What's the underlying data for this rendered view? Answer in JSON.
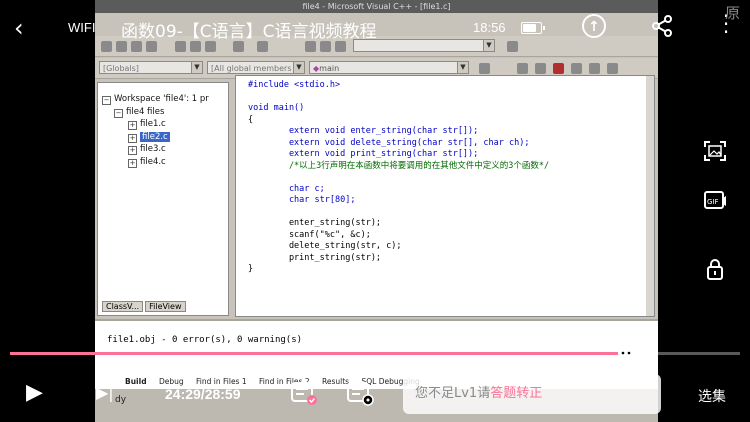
{
  "topbar": {
    "network": "WIFI",
    "title": "函数09-【C语言】C语言视频教程",
    "clock": "18:56",
    "watermark": "原"
  },
  "vs": {
    "window_title": "file4 - Microsoft Visual C++ - [file1.c]",
    "globals_combo": "[Globals]",
    "members_combo": "[All global members",
    "function_combo": "main",
    "workspace_label": "Workspace 'file4': 1 pr",
    "project_label": "file4 files",
    "files": [
      "file1.c",
      "file2.c",
      "file3.c",
      "file4.c"
    ],
    "ws_tabs": [
      "ClassV...",
      "FileView"
    ],
    "code_lines": [
      "#include <stdio.h>",
      "",
      "void main()",
      "{",
      "        extern void enter_string(char str[]);",
      "        extern void delete_string(char str[], char ch);",
      "        extern void print_string(char str[]);",
      "        /*以上3行声明在本函数中将要调用的在其他文件中定义的3个函数*/",
      "",
      "        char c;",
      "        char str[80];",
      "",
      "        enter_string(str);",
      "        scanf(\"%c\", &c);",
      "        delete_string(str, c);",
      "        print_string(str);",
      "}"
    ],
    "build_output": "file1.obj - 0 error(s), 0 warning(s)",
    "output_tabs": [
      "Build",
      "Debug",
      "Find in Files 1",
      "Find in Files 2",
      "Results",
      "SQL Debugging"
    ],
    "status_text": "dy"
  },
  "player": {
    "time": "24:29/28:59",
    "progress": 0.845,
    "danmu_placeholder": "您不足Lv1请",
    "danmu_link": "答题转正",
    "episodes_label": "选集",
    "colors": {
      "accent": "#fb7299"
    }
  }
}
